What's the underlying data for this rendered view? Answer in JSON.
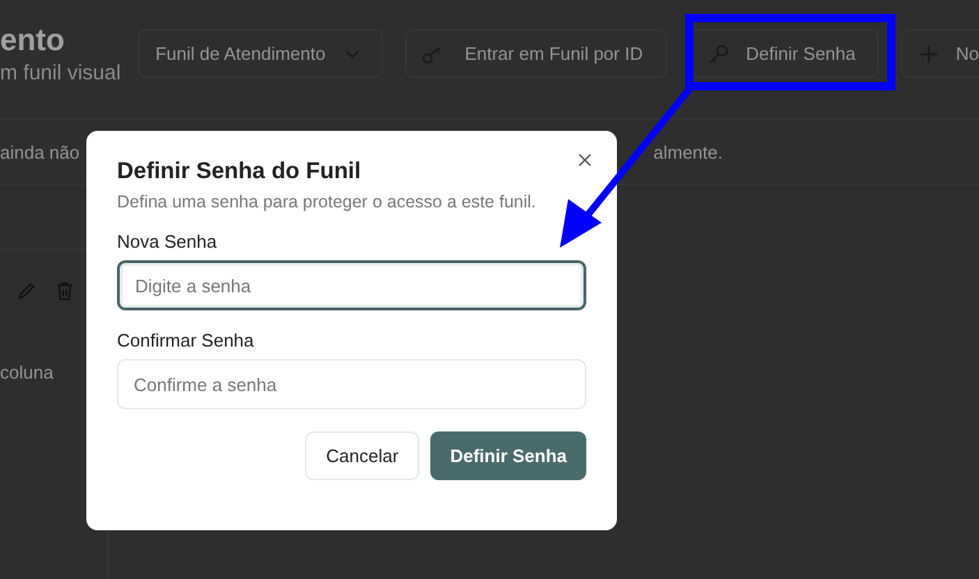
{
  "header": {
    "title": "ento",
    "subtitle": "m funil visual"
  },
  "toolbar": [
    {
      "kind": "dropdown",
      "label": "Funil de Atendimento"
    },
    {
      "kind": "key",
      "label": "Entrar em Funil por ID"
    },
    {
      "kind": "password",
      "label": "Definir Senha"
    },
    {
      "kind": "add",
      "label": "No"
    }
  ],
  "notice": {
    "left": "ainda não",
    "right": "almente."
  },
  "column": {
    "text": "coluna"
  },
  "dialog": {
    "title": "Definir Senha do Funil",
    "description": "Defina uma senha para proteger o acesso a este funil.",
    "fields": [
      {
        "label": "Nova Senha",
        "placeholder": "Digite a senha",
        "focused": true
      },
      {
        "label": "Confirmar Senha",
        "placeholder": "Confirme a senha",
        "focused": false
      }
    ],
    "buttons": [
      {
        "kind": "secondary",
        "label": "Cancelar"
      },
      {
        "kind": "primary",
        "label": "Definir Senha"
      }
    ]
  }
}
